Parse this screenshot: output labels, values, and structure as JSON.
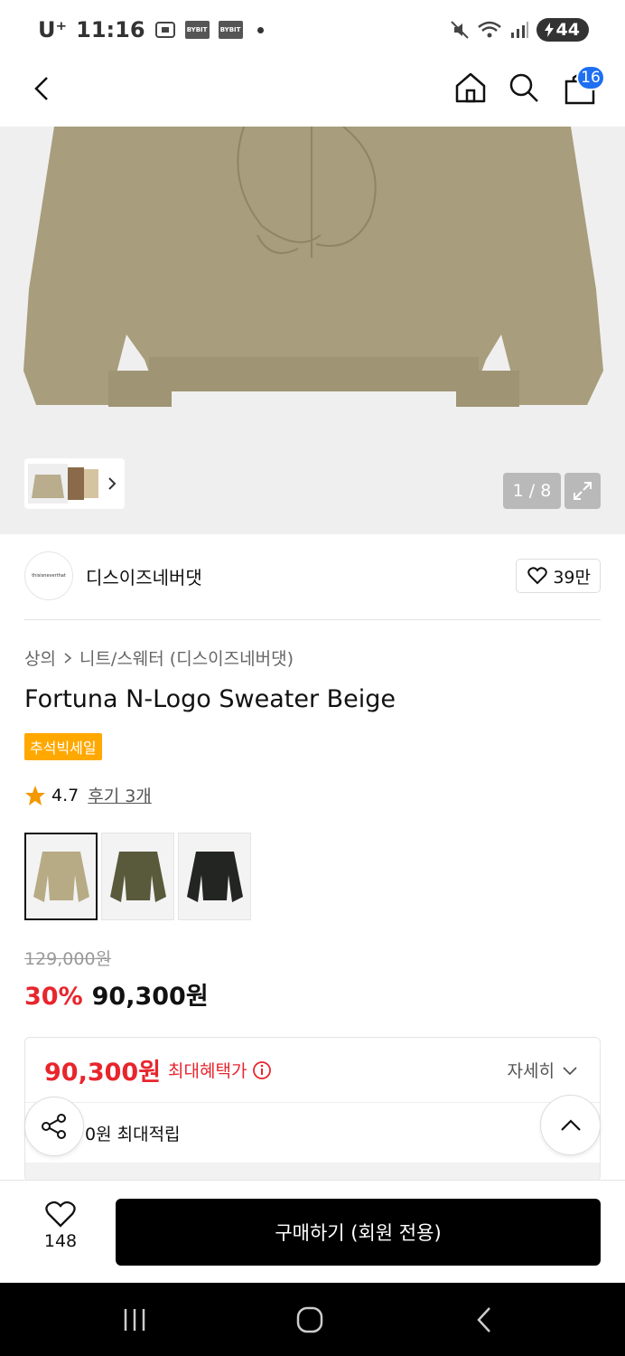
{
  "status_bar": {
    "carrier": "U⁺",
    "time": "11:16",
    "app_badges": [
      "BYBIT",
      "BYBIT"
    ],
    "battery": "44"
  },
  "nav": {
    "cart_count": "16",
    "icons": [
      "back-icon",
      "home-icon",
      "search-icon",
      "cart-icon"
    ]
  },
  "gallery": {
    "pager": "1 / 8",
    "colors": {
      "sweater": "#a89d7c",
      "background": "#efefef"
    }
  },
  "brand": {
    "logo_text": "thisisneverthat",
    "name": "디스이즈네버댓",
    "likes": "39만"
  },
  "product": {
    "breadcrumb": [
      "상의",
      "니트/스웨터 (디스이즈네버댓)"
    ],
    "title": "Fortuna N-Logo Sweater Beige",
    "sale_badge": "추석빅세일",
    "rating": "4.7",
    "reviews": "후기 3개",
    "color_options": [
      {
        "color": "#b7ab86",
        "selected": true
      },
      {
        "color": "#585a3b",
        "selected": false
      },
      {
        "color": "#232522",
        "selected": false
      }
    ],
    "original_price": "129,000원",
    "discount": "30%",
    "price": "90,300원"
  },
  "benefit": {
    "max_price": "90,300원",
    "max_label": "최대혜택가",
    "detail_label": "자세히",
    "points": "0원 최대적립"
  },
  "bottom": {
    "wish_count": "148",
    "buy_label": "구매하기 (회원 전용)"
  },
  "accent": {
    "red": "#e8252d",
    "blue": "#1e6ff1",
    "orange": "#ffa800"
  }
}
